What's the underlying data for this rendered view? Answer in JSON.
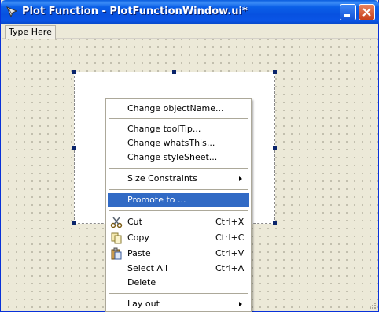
{
  "window": {
    "title": "Plot Function - PlotFunctionWindow.ui*",
    "minimize_icon": "minimize-icon",
    "close_icon": "close-icon",
    "app_icon": "qt-designer-icon"
  },
  "menubar": {
    "placeholder": "Type Here"
  },
  "context_menu": {
    "items": [
      {
        "label": "Change objectName..."
      },
      {
        "label": "Change toolTip..."
      },
      {
        "label": "Change whatsThis..."
      },
      {
        "label": "Change styleSheet..."
      },
      {
        "label": "Size Constraints"
      },
      {
        "label": "Promote to ..."
      },
      {
        "label": "Cut",
        "shortcut": "Ctrl+X",
        "icon": "scissors-icon"
      },
      {
        "label": "Copy",
        "shortcut": "Ctrl+C",
        "icon": "copy-icon"
      },
      {
        "label": "Paste",
        "shortcut": "Ctrl+V",
        "icon": "paste-icon"
      },
      {
        "label": "Select All",
        "shortcut": "Ctrl+A"
      },
      {
        "label": "Delete"
      },
      {
        "label": "Lay out"
      }
    ]
  },
  "colors": {
    "titlebar": "#0a55e6",
    "highlight": "#316ac5",
    "handle": "#0a246a"
  }
}
